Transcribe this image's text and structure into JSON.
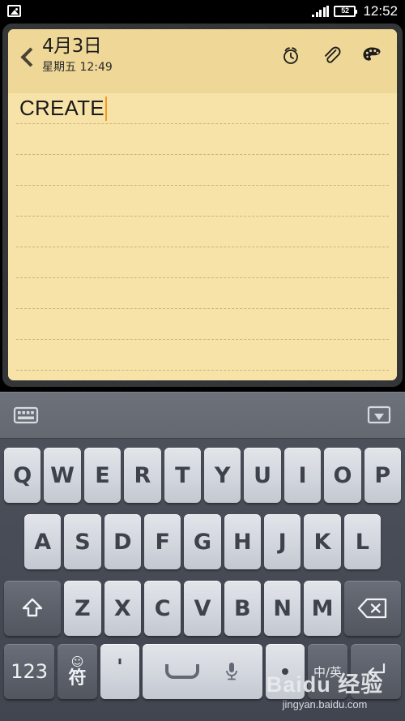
{
  "status_bar": {
    "notification_icon": "photo-icon",
    "signal_icon": "signal-bars-icon",
    "battery_level": "52",
    "time": "12:52"
  },
  "note": {
    "back_icon": "chevron-left-icon",
    "date_title": "4月3日",
    "subtitle": "星期五 12:49",
    "actions": [
      {
        "name": "alarm-icon",
        "label": "闹钟"
      },
      {
        "name": "attachment-icon",
        "label": "附件"
      },
      {
        "name": "palette-icon",
        "label": "主题"
      }
    ],
    "body_text": "CREATE",
    "caret_color": "#F59A23",
    "paper_color": "#F7E3A8",
    "header_color": "#EFD897",
    "rule_color": "#C9B47A",
    "rule_count": 9
  },
  "keyboard": {
    "toolbar": {
      "switch_icon": "keyboard-switch-icon",
      "hide_icon": "hide-keyboard-icon"
    },
    "row1": [
      "Q",
      "W",
      "E",
      "R",
      "T",
      "Y",
      "U",
      "I",
      "O",
      "P"
    ],
    "row2": [
      "A",
      "S",
      "D",
      "F",
      "G",
      "H",
      "J",
      "K",
      "L"
    ],
    "row3_letters": [
      "Z",
      "X",
      "C",
      "V",
      "B",
      "N",
      "M"
    ],
    "shift_key": {
      "name": "shift-key",
      "icon": "shift-arrow-icon"
    },
    "backspace_key": {
      "name": "backspace-key",
      "icon": "backspace-icon"
    },
    "row4": {
      "numeric": "123",
      "symbol_emoji": "☺",
      "symbol_char": "符",
      "apostrophe": "'",
      "space_icon": "space-bar-icon",
      "mic_icon": "microphone-icon",
      "period": ".",
      "language": "中/英",
      "enter_icon": "enter-key-icon"
    }
  },
  "watermark": {
    "main": "Baidu 经验",
    "sub": "jingyan.baidu.com"
  }
}
